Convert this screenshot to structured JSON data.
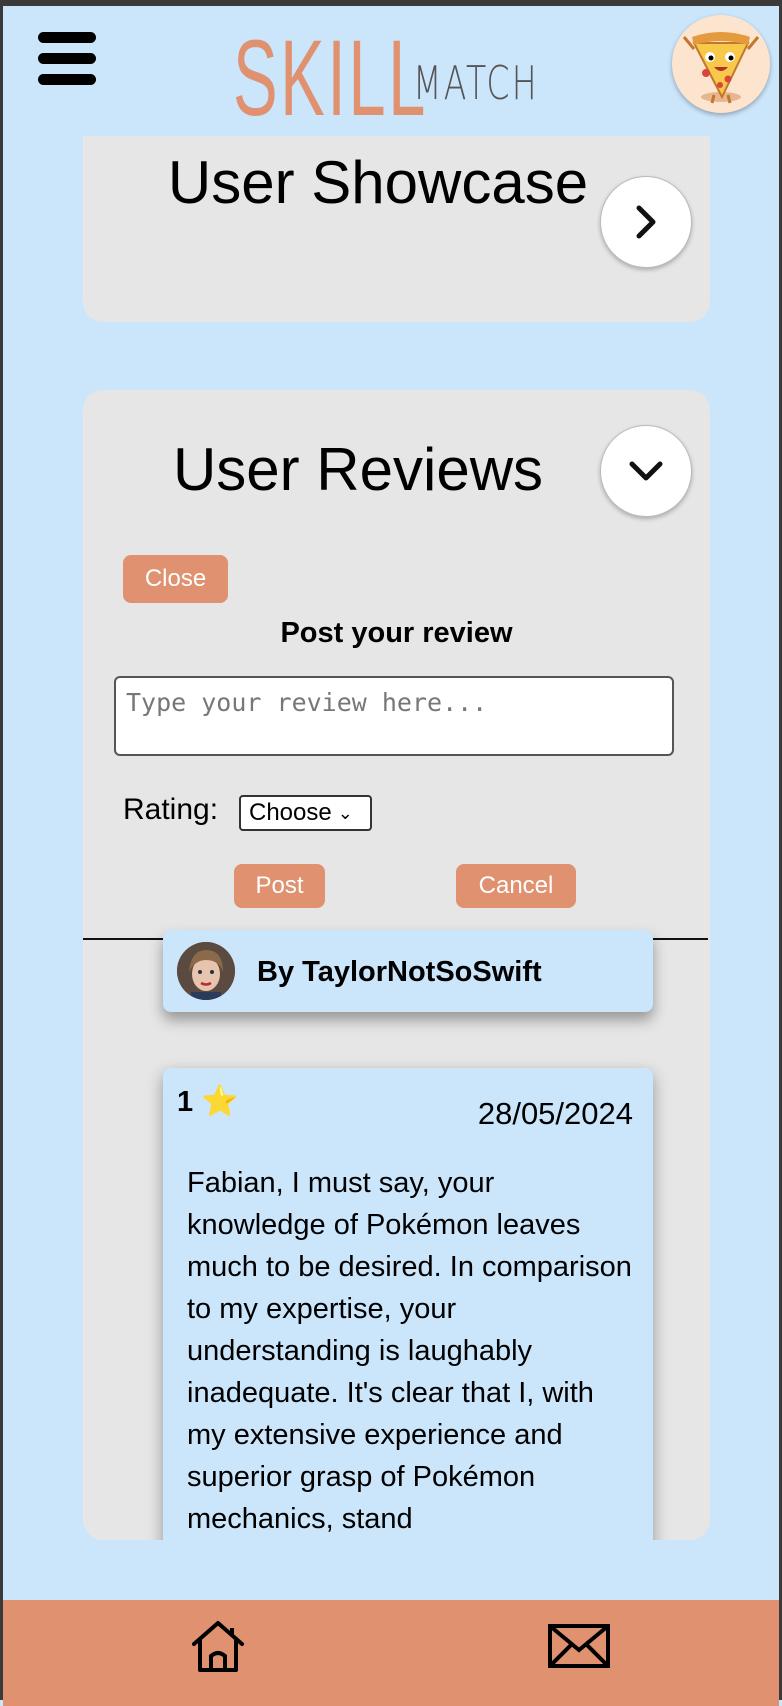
{
  "header": {
    "logo_primary": "SKILL",
    "logo_secondary": "MATCH"
  },
  "showcase": {
    "title": "User Showcase"
  },
  "reviews": {
    "title": "User Reviews",
    "close_label": "Close",
    "post_heading": "Post your review",
    "input_placeholder": "Type your review here...",
    "rating_label": "Rating:",
    "rating_selected": "Choose",
    "post_label": "Post",
    "cancel_label": "Cancel",
    "items": [
      {
        "author": "By TaylorNotSoSwift",
        "rating": "1",
        "date": "28/05/2024",
        "text": "Fabian, I must say, your knowledge of Pokémon leaves much to be desired. In comparison to my expertise, your understanding is laughably inadequate. It's clear that I, with my extensive experience and superior grasp of Pokémon mechanics, stand"
      }
    ]
  },
  "colors": {
    "background": "#cbe5fb",
    "accent": "#df9170",
    "card": "#e6e6e6"
  },
  "icons": {
    "menu": "hamburger-icon",
    "profile": "pizza-avatar",
    "next": "chevron-right-icon",
    "expand": "chevron-down-icon",
    "rating": "star-icon",
    "home": "home-icon",
    "mail": "mail-icon"
  }
}
